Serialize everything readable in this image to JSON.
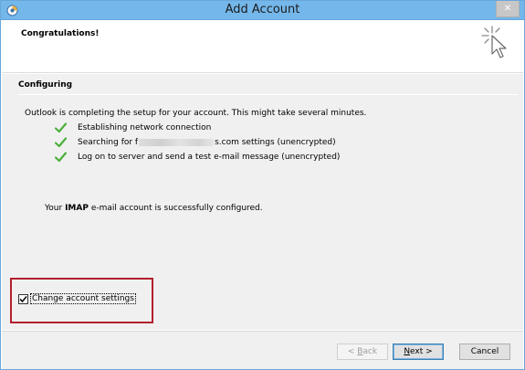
{
  "window": {
    "title": "Add Account",
    "close_glyph": "✕"
  },
  "header": {
    "title": "Congratulations!"
  },
  "content": {
    "section_title": "Configuring",
    "intro": "Outlook is completing the setup for your account. This might take several minutes.",
    "steps": [
      {
        "label": "Establishing network connection"
      },
      {
        "label_before": "Searching for f",
        "label_after": "s.com settings (unencrypted)"
      },
      {
        "label": "Log on to server and send a test e-mail message (unencrypted)"
      }
    ],
    "result": {
      "before": "Your ",
      "bold": "IMAP",
      "after": " e-mail account is successfully configured."
    },
    "change_settings": {
      "label": "Change account settings",
      "checked": true
    }
  },
  "footer": {
    "back_prefix": "< ",
    "back_key": "B",
    "back_rest": "ack",
    "next_key": "N",
    "next_rest": "ext >",
    "cancel": "Cancel"
  },
  "colors": {
    "titlebar": "#74b7ea",
    "check_green": "#4caf3c",
    "highlight_red": "#b21f2d"
  },
  "icons": {
    "app": "outlook-app-icon",
    "header": "wizard-sparkle-cursor-icon",
    "step": "green-check-icon"
  }
}
